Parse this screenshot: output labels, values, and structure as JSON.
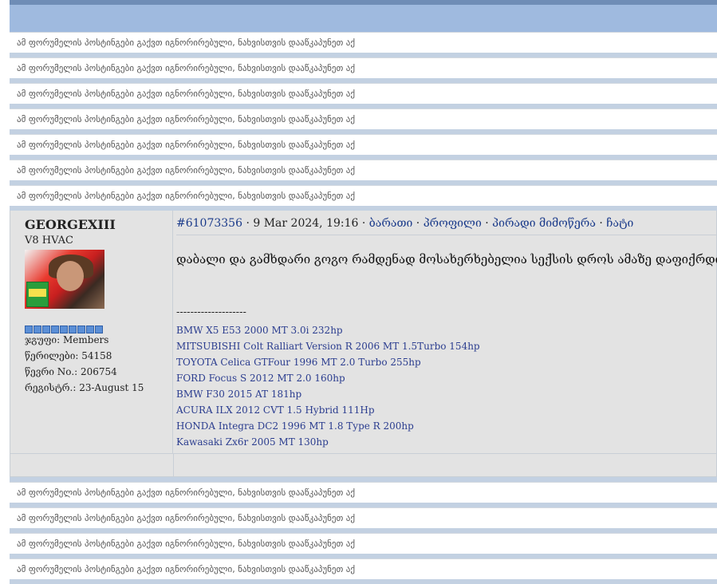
{
  "ignored_text": "ამ ფორუმელის პოსტინგები გაქვთ იგნორირებული, ნახვისთვის დააწკაპუნეთ აქ",
  "ignored_rows_top": [
    {
      "text": "ამ ფორუმელის პოსტინგები გაქვთ იგნორირებული, ნახვისთვის დააწკაპუნეთ აქ"
    },
    {
      "text": "ამ ფორუმელის პოსტინგები გაქვთ იგნორირებული, ნახვისთვის დააწკაპუნეთ აქ"
    },
    {
      "text": "ამ ფორუმელის პოსტინგები გაქვთ იგნორირებული, ნახვისთვის დააწკაპუნეთ აქ"
    },
    {
      "text": "ამ ფორუმელის პოსტინგები გაქვთ იგნორირებული, ნახვისთვის დააწკაპუნეთ აქ"
    },
    {
      "text": "ამ ფორუმელის პოსტინგები გაქვთ იგნორირებული, ნახვისთვის დააწკაპუნეთ აქ"
    },
    {
      "text": "ამ ფორუმელის პოსტინგები გაქვთ იგნორირებული, ნახვისთვის დააწკაპუნეთ აქ"
    },
    {
      "text": "ამ ფორუმელის პოსტინგები გაქვთ იგნორირებული, ნახვისთვის დააწკაპუნეთ აქ"
    }
  ],
  "ignored_rows_bottom": [
    {
      "text": "ამ ფორუმელის პოსტინგები გაქვთ იგნორირებული, ნახვისთვის დააწკაპუნეთ აქ"
    },
    {
      "text": "ამ ფორუმელის პოსტინგები გაქვთ იგნორირებული, ნახვისთვის დააწკაპუნეთ აქ"
    },
    {
      "text": "ამ ფორუმელის პოსტინგები გაქვთ იგნორირებული, ნახვისთვის დააწკაპუნეთ აქ"
    },
    {
      "text": "ამ ფორუმელის პოსტინგები გაქვთ იგნორირებული, ნახვისთვის დააწკაპუნეთ აქ"
    }
  ],
  "post": {
    "author": "GEORGEXIII",
    "user_title": "V8 HVAC",
    "rank_pips": 9,
    "group_label": "ჯგუფი: Members",
    "posts_label": "წერილები: 54158",
    "member_no_label": "წევრი No.: 206754",
    "registered_label": "რეგისტრ.: 23-August 15",
    "post_id": "#61073356",
    "date": "9 Mar 2024, 19:16",
    "actions": [
      "ბარათი",
      "პროფილი",
      "პირადი მიმოწერა",
      "ჩატი"
    ],
    "separator": "·",
    "body": "დაბალი და გამხდარი გოგო რამდენად მოსახერხებელია სექსის დროს ამაზე დაფიქრდით.",
    "signature_divider": "--------------------",
    "signature": [
      "BMW X5 E53 2000 MT 3.0i 232hp",
      "MITSUBISHI Colt Ralliart Version R 2006 MT 1.5Turbo 154hp",
      "TOYOTA Celica GTFour 1996 MT 2.0 Turbo 255hp",
      "FORD Focus S 2012 MT 2.0 160hp",
      "BMW F30 2015 AT 181hp",
      "ACURA ILX 2012 CVT 1.5 Hybrid 111Hp",
      "HONDA Integra DC2 1996 MT 1.8 Type R 200hp",
      "Kawasaki Zx6r 2005 MT 130hp"
    ]
  },
  "colors": {
    "header_bar": "#9fbadf",
    "top_stripe": "#6f8db6",
    "separator": "#c3d1e2",
    "post_bg": "#e3e3e3",
    "link": "#1a3a8a",
    "signature_link": "#2b3d8f",
    "rank_pip": "#5b8fd6"
  }
}
